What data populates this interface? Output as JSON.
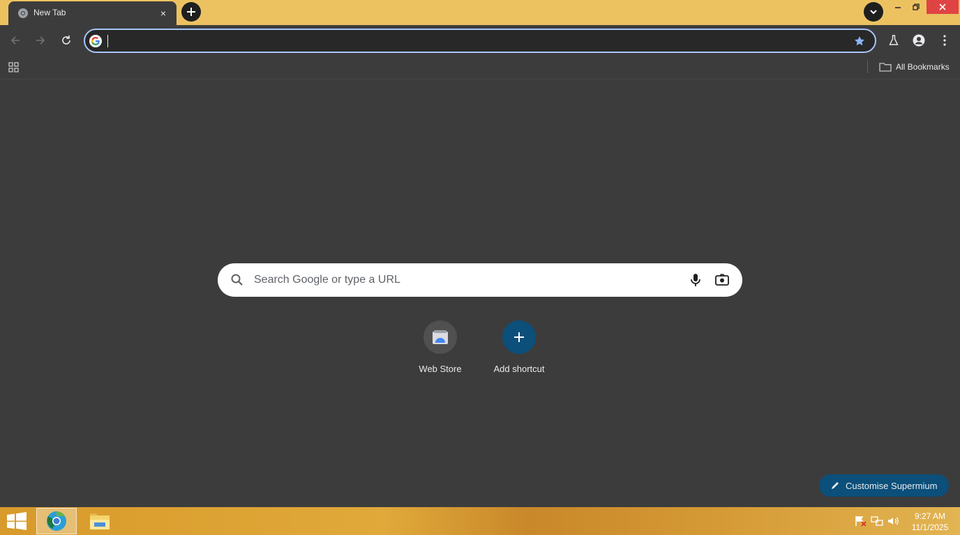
{
  "browser": {
    "tab": {
      "title": "New Tab",
      "close_glyph": "×"
    },
    "new_tab_glyph": "+",
    "window_controls": {
      "minimize": "minimize-icon",
      "maximize": "restore-icon",
      "close": "close-icon"
    },
    "omnibox": {
      "value": "",
      "engine_icon": "google-g-icon",
      "bookmark_star_color": "#8ab4f8"
    },
    "toolbar_icons": [
      "back-arrow-icon",
      "forward-arrow-icon",
      "reload-icon",
      "labs-flask-icon",
      "profile-icon",
      "kebab-menu-icon"
    ]
  },
  "bookmarks_bar": {
    "all_bookmarks_label": "All Bookmarks"
  },
  "ntp": {
    "search_placeholder": "Search Google or type a URL",
    "shortcuts": [
      {
        "label": "Web Store",
        "icon": "web-store-icon"
      },
      {
        "label": "Add shortcut",
        "icon": "plus-icon"
      }
    ],
    "customise_label": "Customise Supermium"
  },
  "taskbar": {
    "apps": [
      "supermium-browser-icon",
      "file-explorer-icon"
    ],
    "clock": {
      "time": "9:27 AM",
      "date": "11/1/2025"
    }
  },
  "colors": {
    "accent": "#ecc261",
    "background": "#3c3c3c",
    "omnibox_border": "#a8c7fa",
    "customise_button": "#0b4f7a",
    "close_button": "#e04343"
  }
}
